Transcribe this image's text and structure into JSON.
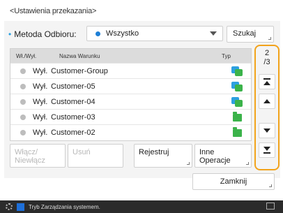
{
  "title": "<Ustawienia przekazania>",
  "method": {
    "label": "Metoda Odbioru:",
    "selected": "Wszystko"
  },
  "search_label": "Szukaj",
  "table": {
    "headers": [
      "Wł./Wył.",
      "Nazwa Warunku",
      "Typ"
    ],
    "rows": [
      {
        "status": "Wył.",
        "name": "Customer-Group",
        "type_icon": "group-icon"
      },
      {
        "status": "Wył.",
        "name": "Customer-05",
        "type_icon": "group-icon"
      },
      {
        "status": "Wył.",
        "name": "Customer-04",
        "type_icon": "group-icon"
      },
      {
        "status": "Wył.",
        "name": "Customer-03",
        "type_icon": "folder-icon"
      },
      {
        "status": "Wył.",
        "name": "Customer-02",
        "type_icon": "folder-icon"
      }
    ]
  },
  "pager": {
    "current": "2",
    "total": "/3"
  },
  "actions": {
    "toggle_line1": "Włącz/",
    "toggle_line2": "Niewłącz",
    "delete": "Usuń",
    "register": "Rejestruj",
    "other_line1": "Inne",
    "other_line2": "Operacje"
  },
  "close_label": "Zamknij",
  "status_text": "Tryb Zarządzania systemem.",
  "colors": {
    "accent": "#f2a31b",
    "blue": "#1e7fd6",
    "green": "#3bb34a"
  }
}
